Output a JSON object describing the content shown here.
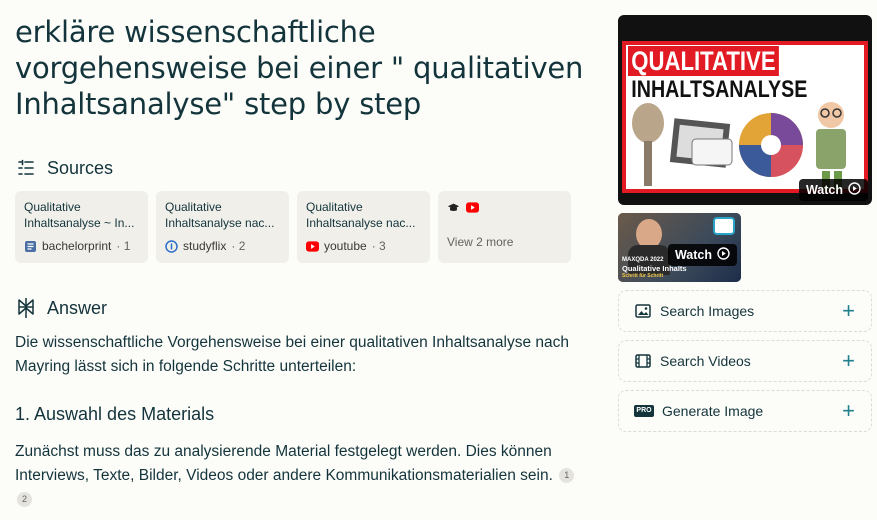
{
  "query": "erkläre wissenschaftliche vorgehensweise bei einer \" qualitativen Inhaltsanalyse\" step by step",
  "sources_section": {
    "label": "Sources"
  },
  "sources": [
    {
      "title_line1": "Qualitative",
      "title_line2": "Inhaltsanalyse ~ In...",
      "site": "bachelorprint",
      "index": "· 1",
      "icon": "book-icon"
    },
    {
      "title_line1": "Qualitative",
      "title_line2": "Inhaltsanalyse nac...",
      "site": "studyflix",
      "index": "· 2",
      "icon": "studyflix-icon"
    },
    {
      "title_line1": "Qualitative",
      "title_line2": "Inhaltsanalyse nac...",
      "site": "youtube",
      "index": "· 3",
      "icon": "youtube-icon"
    }
  ],
  "view_more": {
    "label": "View 2 more",
    "icons": [
      "graduation-cap-icon",
      "youtube-icon"
    ]
  },
  "answer_section": {
    "label": "Answer"
  },
  "answer": {
    "intro": "Die wissenschaftliche Vorgehensweise bei einer qualitativen Inhaltsanalyse nach Mayring lässt sich in folgende Schritte unterteilen:",
    "step1_heading": "1. Auswahl des Materials",
    "step1_text": "Zunächst muss das zu analysierende Material festgelegt werden. Dies können Interviews, Texte, Bilder, Videos oder andere Kommunikationsmaterialien sein.",
    "citations": [
      "1",
      "2"
    ]
  },
  "video_main": {
    "thumb_line1": "QUALITATIVE",
    "thumb_line2": "INHALTSANALYSE",
    "watch_label": "Watch"
  },
  "video_second": {
    "thumb_line1": "MAXQDA 2022",
    "thumb_line2": "Qualitative Inhalts",
    "thumb_line3": "Schritt für Schritt",
    "watch_label": "Watch"
  },
  "side_actions": [
    {
      "label": "Search Images",
      "icon": "image-icon"
    },
    {
      "label": "Search Videos",
      "icon": "film-icon"
    },
    {
      "label": "Generate Image",
      "icon": "pro-icon",
      "badge": "PRO"
    }
  ],
  "colors": {
    "accent": "#20808d",
    "text": "#13343b",
    "background": "#fcfcf9",
    "card": "#f0efea",
    "thumb_red": "#e21a23",
    "youtube_red": "#ff0000"
  }
}
